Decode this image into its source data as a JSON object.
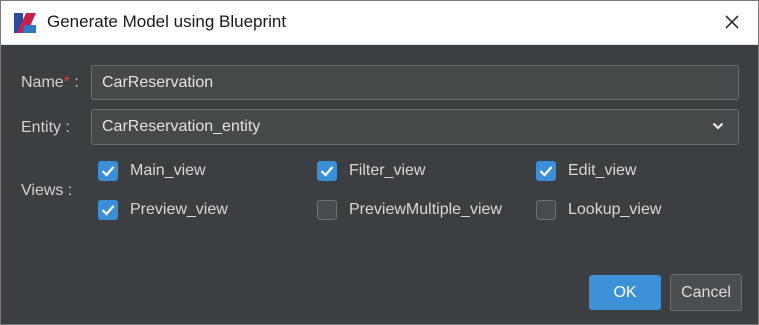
{
  "window": {
    "title": "Generate Model using Blueprint"
  },
  "form": {
    "name_label": "Name",
    "name_required_mark": "*",
    "name_colon": " :",
    "name_value": "CarReservation",
    "entity_label": "Entity :",
    "entity_value": "CarReservation_entity",
    "views_label": "Views :",
    "views": [
      {
        "label": "Main_view",
        "checked": true
      },
      {
        "label": "Filter_view",
        "checked": true
      },
      {
        "label": "Edit_view",
        "checked": true
      },
      {
        "label": "Preview_view",
        "checked": true
      },
      {
        "label": "PreviewMultiple_view",
        "checked": false
      },
      {
        "label": "Lookup_view",
        "checked": false
      }
    ]
  },
  "buttons": {
    "ok": "OK",
    "cancel": "Cancel"
  },
  "colors": {
    "accent": "#3e90d8",
    "background": "#3c3f41",
    "required": "#e0403a"
  },
  "icons": {
    "app": "blueprint-app-icon",
    "close": "close-icon",
    "dropdown": "chevron-down-icon",
    "check": "checkmark-icon"
  }
}
